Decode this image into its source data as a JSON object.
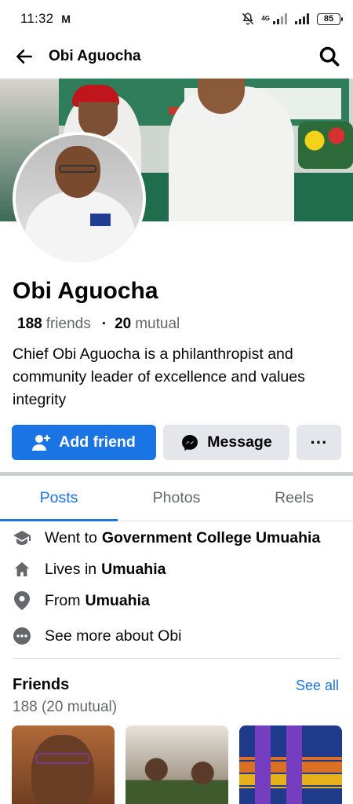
{
  "status_bar": {
    "time": "11:32",
    "notification_letter": "M",
    "network": "4G",
    "battery": "85"
  },
  "app_bar": {
    "title": "Obi Aguocha"
  },
  "profile": {
    "name": "Obi Aguocha",
    "friends_count": "188",
    "friends_label": "friends",
    "mutual_count": "20",
    "mutual_label": "mutual",
    "bio": "Chief Obi Aguocha is a philanthropist and community leader of excellence and values integrity"
  },
  "actions": {
    "add_friend": "Add friend",
    "message": "Message",
    "more": "···"
  },
  "tabs": [
    {
      "label": "Posts",
      "active": true
    },
    {
      "label": "Photos",
      "active": false
    },
    {
      "label": "Reels",
      "active": false
    }
  ],
  "details": {
    "education_prefix": "Went to",
    "education_value": "Government College Umuahia",
    "lives_prefix": "Lives in",
    "lives_value": "Umuahia",
    "from_prefix": "From",
    "from_value": "Umuahia",
    "see_more": "See more about Obi"
  },
  "friends_section": {
    "title": "Friends",
    "see_all": "See all",
    "count": "188 (20 mutual)"
  },
  "colors": {
    "accent": "#1b74e4",
    "secondary_button": "#e4e6eb",
    "muted_text": "#65676b"
  }
}
